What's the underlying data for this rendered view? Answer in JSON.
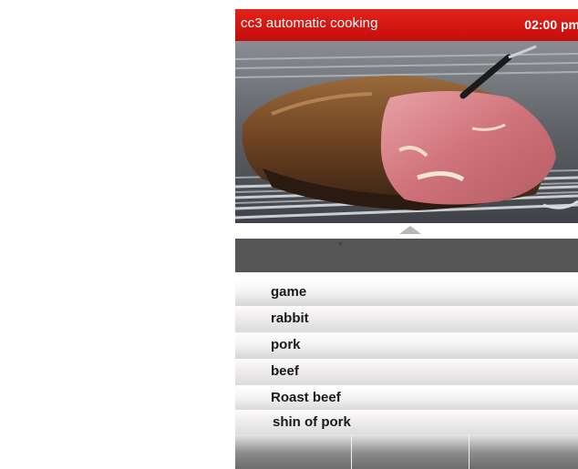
{
  "header": {
    "title": "cc3 automatic cooking",
    "time": "02:00 pm"
  },
  "menu": {
    "items": [
      {
        "label": "game"
      },
      {
        "label": "rabbit"
      },
      {
        "label": "pork"
      },
      {
        "label": "beef"
      },
      {
        "label": "Roast beef"
      },
      {
        "label": "shin of pork"
      }
    ]
  },
  "colors": {
    "header": "#d8151a",
    "dark_bar": "#555555"
  },
  "icons": {
    "scroll_up": "up-arrow-icon"
  }
}
